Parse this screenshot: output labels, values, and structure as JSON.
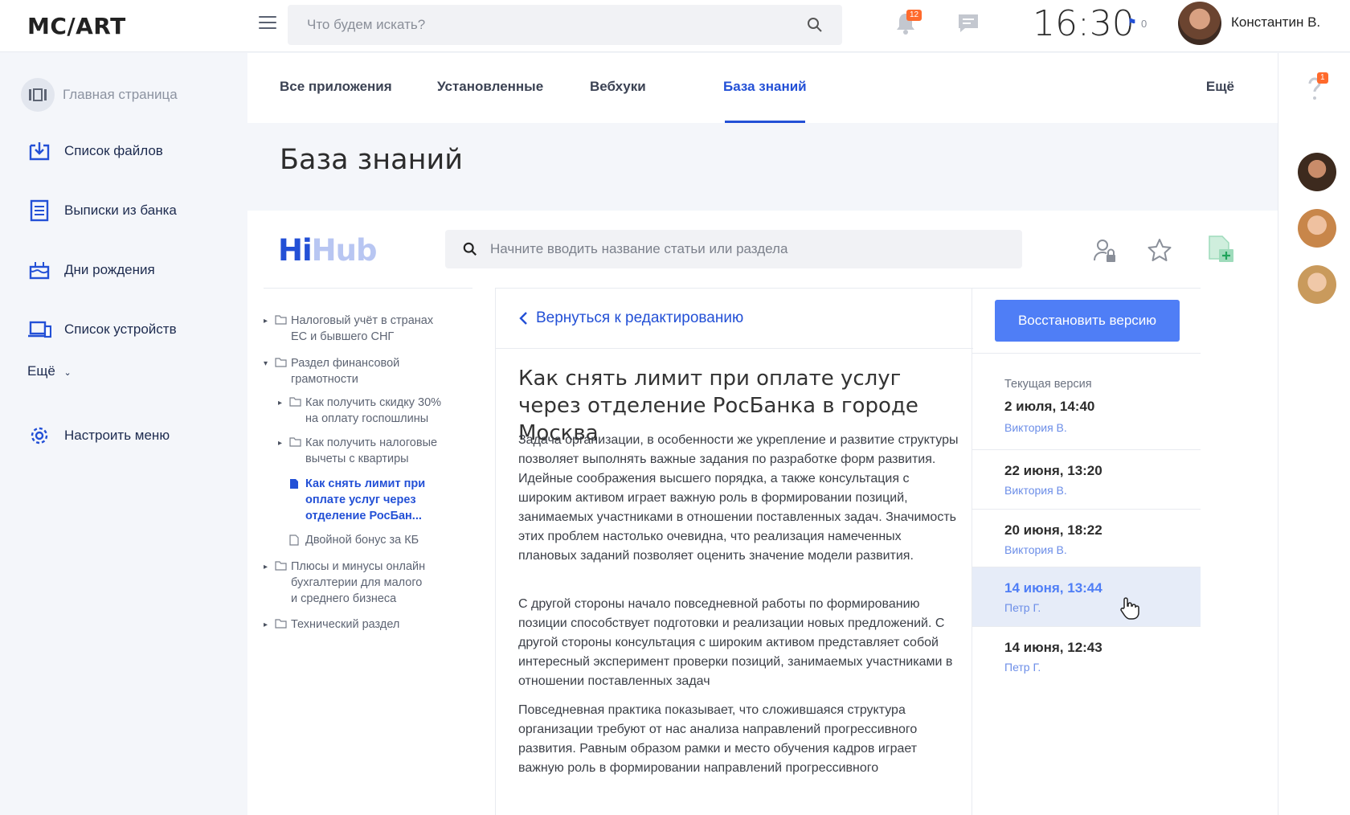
{
  "header": {
    "logo": "MC/ART",
    "search_placeholder": "Что будем искать?",
    "notifications_count": "12",
    "clock": "16:30",
    "flag_count": "0",
    "user_name": "Константин В."
  },
  "sidebar": {
    "items": [
      {
        "label": "Главная страница",
        "icon": "home-icon"
      },
      {
        "label": "Список файлов",
        "icon": "download-icon"
      },
      {
        "label": "Выписки из банка",
        "icon": "statement-icon"
      },
      {
        "label": "Дни рождения",
        "icon": "cake-icon"
      },
      {
        "label": "Список устройств",
        "icon": "devices-icon"
      }
    ],
    "more": "Ещё",
    "settings": "Настроить меню"
  },
  "tabs": {
    "items": [
      "Все приложения",
      "Установленные",
      "Вебхуки",
      "База знаний"
    ],
    "active": "База знаний",
    "more": "Ещё"
  },
  "page_title": "База знаний",
  "kb": {
    "brand_hi": "Hi",
    "brand_hub": "Hub",
    "search_placeholder": "Начните вводить название статьи или раздела"
  },
  "tree": {
    "items": [
      {
        "lines": [
          "Налоговый учёт в странах",
          "ЕС и бывшего СНГ"
        ]
      },
      {
        "lines": [
          "Раздел финансовой",
          "грамотности"
        ]
      },
      {
        "lines": [
          "Как получить скидку 30%",
          "на оплату госпошлины"
        ]
      },
      {
        "lines": [
          "Как получить налоговые",
          "вычеты с квартиры"
        ]
      },
      {
        "lines": [
          "Как снять лимит при",
          "оплате услуг через",
          "отделение РосБан..."
        ]
      },
      {
        "lines": [
          "Двойной бонус за КБ"
        ]
      },
      {
        "lines": [
          "Плюсы и минусы онлайн",
          "бухгалтерии для малого",
          "и среднего бизнеса"
        ]
      },
      {
        "lines": [
          "Технический раздел"
        ]
      }
    ]
  },
  "article": {
    "back_label": "Вернуться к редактированию",
    "title": "Как снять лимит при оплате услуг через отделение РосБанка в городе Москва",
    "paragraphs": [
      "Задача организации, в особенности же укрепление и развитие структуры позволяет выполнять важные задания по разработке форм развития. Идейные соображения высшего порядка, а также консультация с широким активом играет важную роль в формировании позиций, занимаемых участниками в отношении поставленных задач. Значимость этих проблем настолько очевидна, что реализация намеченных плановых заданий позволяет оценить значение модели развития.",
      "С другой стороны начало повседневной работы по формированию позиции способствует подготовки и реализации новых предложений. С другой стороны консультация с широким активом представляет собой интересный эксперимент проверки позиций, занимаемых участниками в отношении поставленных задач",
      "Повседневная практика показывает, что сложившаяся структура организации требуют от нас анализа направлений прогрессивного развития. Равным образом рамки и место обучения кадров играет важную роль в формировании направлений прогрессивного"
    ]
  },
  "versions": {
    "restore_button": "Восстановить версию",
    "current_label": "Текущая версия",
    "items": [
      {
        "date": "2 июля, 14:40",
        "author": "Виктория В."
      },
      {
        "date": "22 июня, 13:20",
        "author": "Виктория В."
      },
      {
        "date": "20 июня, 18:22",
        "author": "Виктория В."
      },
      {
        "date": "14 июня, 13:44",
        "author": "Петр Г."
      },
      {
        "date": "14 июня, 12:43",
        "author": "Петр Г."
      }
    ]
  },
  "rail": {
    "help_badge": "1"
  },
  "colors": {
    "accent": "#2350d6",
    "button": "#4f7ef6",
    "badge": "#ff6a2c",
    "selected_row": "#e6ecf8"
  }
}
